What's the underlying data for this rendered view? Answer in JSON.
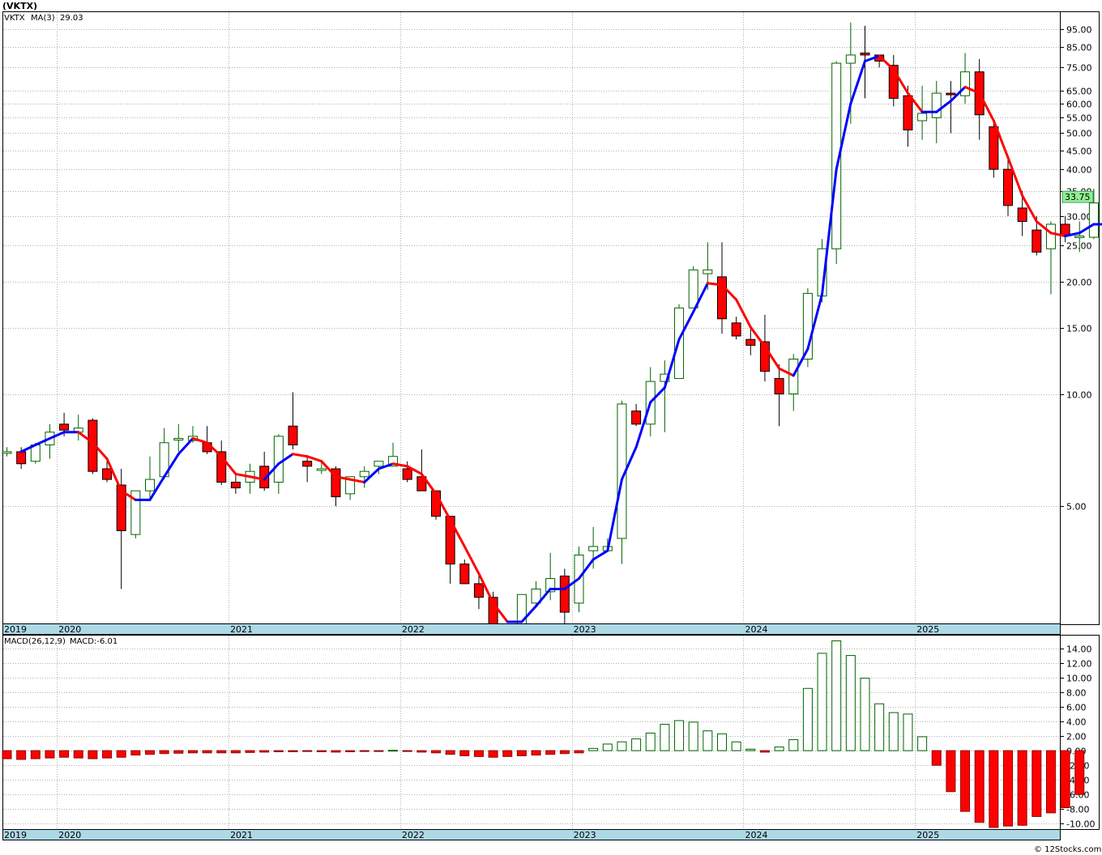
{
  "header": {
    "ticker": "(VKTX)"
  },
  "price_legend": {
    "symbol": "VKTX",
    "ma_label": "MA(3)",
    "ma_value": "29.03"
  },
  "macd_legend": {
    "label": "MACD(26,12,9)",
    "value_label": "MACD:-6.01"
  },
  "last_price_tag": "33.75",
  "watermark": "© 12Stocks.com",
  "colors": {
    "up": "#006400",
    "down": "#ff0000",
    "ma_up": "#0000ff",
    "ma_down": "#ff0000",
    "grid": "#b0b0b0",
    "time_band": "#add8e6",
    "price_tag": "#90ee90"
  },
  "chart_data": [
    {
      "type": "candlestick",
      "title": "(VKTX)",
      "scale": "log",
      "ylim": [
        2.45,
        105
      ],
      "grid": true,
      "y_ticks": [
        "95.00",
        "85.00",
        "75.00",
        "65.00",
        "60.00",
        "55.00",
        "50.00",
        "45.00",
        "40.00",
        "35.00",
        "30.00",
        "25.00",
        "20.00",
        "15.00",
        "10.00",
        "5.00"
      ],
      "x_labels": [
        "2019",
        "2020",
        "2021",
        "2022",
        "2023",
        "2024",
        "2025"
      ],
      "x_label_index": [
        0,
        4,
        16,
        28,
        40,
        52,
        64
      ],
      "candles": [
        [
          7.0,
          7.2,
          6.8,
          7.0
        ],
        [
          7.0,
          7.2,
          6.3,
          6.5
        ],
        [
          6.6,
          7.4,
          6.5,
          7.3
        ],
        [
          7.3,
          8.3,
          6.7,
          7.9
        ],
        [
          8.3,
          8.9,
          7.7,
          8.0
        ],
        [
          7.9,
          8.8,
          7.5,
          8.1
        ],
        [
          8.5,
          8.6,
          6.1,
          6.2
        ],
        [
          6.3,
          6.6,
          5.8,
          5.9
        ],
        [
          5.7,
          6.3,
          3.0,
          4.3
        ],
        [
          4.2,
          5.4,
          4.1,
          5.5
        ],
        [
          5.5,
          6.8,
          5.2,
          5.9
        ],
        [
          6.0,
          8.1,
          5.9,
          7.4
        ],
        [
          7.6,
          8.3,
          7.0,
          7.6
        ],
        [
          7.5,
          8.2,
          7.4,
          7.7
        ],
        [
          7.4,
          8.2,
          6.9,
          7.0
        ],
        [
          7.0,
          7.5,
          5.7,
          5.8
        ],
        [
          5.8,
          6.1,
          5.4,
          5.6
        ],
        [
          5.8,
          6.5,
          5.4,
          6.2
        ],
        [
          6.4,
          7.0,
          5.5,
          5.6
        ],
        [
          5.8,
          7.8,
          5.4,
          7.7
        ],
        [
          8.2,
          10.1,
          7.1,
          7.3
        ],
        [
          6.6,
          6.8,
          5.8,
          6.4
        ],
        [
          6.3,
          6.6,
          6.1,
          6.3
        ],
        [
          6.3,
          6.4,
          5.0,
          5.3
        ],
        [
          5.4,
          6.0,
          5.2,
          6.0
        ],
        [
          6.0,
          6.4,
          5.6,
          6.2
        ],
        [
          6.4,
          6.6,
          6.1,
          6.6
        ],
        [
          6.4,
          7.4,
          6.4,
          6.8
        ],
        [
          6.3,
          6.6,
          5.8,
          5.9
        ],
        [
          6.0,
          7.1,
          5.6,
          5.5
        ],
        [
          5.5,
          5.5,
          4.6,
          4.7
        ],
        [
          4.7,
          4.7,
          3.1,
          3.5
        ],
        [
          3.5,
          3.6,
          3.1,
          3.1
        ],
        [
          3.1,
          3.3,
          2.65,
          2.85
        ],
        [
          2.85,
          2.95,
          2.2,
          2.3
        ],
        [
          2.2,
          2.3,
          2.1,
          2.1
        ],
        [
          2.3,
          2.9,
          2.05,
          2.9
        ],
        [
          2.75,
          3.15,
          2.7,
          3.0
        ],
        [
          2.95,
          3.75,
          2.8,
          3.2
        ],
        [
          3.25,
          3.4,
          2.4,
          2.6
        ],
        [
          2.75,
          3.9,
          2.6,
          3.7
        ],
        [
          3.8,
          4.4,
          3.4,
          3.9
        ],
        [
          3.8,
          4.1,
          3.9,
          3.9
        ],
        [
          4.1,
          9.6,
          3.5,
          9.4
        ],
        [
          9.0,
          9.4,
          8.2,
          8.3
        ],
        [
          8.3,
          11.8,
          7.7,
          10.8
        ],
        [
          10.8,
          12.3,
          7.9,
          11.3
        ],
        [
          11.0,
          17.4,
          11.3,
          17.0
        ],
        [
          17.0,
          22.0,
          17.0,
          21.5
        ],
        [
          21.0,
          25.5,
          19.0,
          21.5
        ],
        [
          20.6,
          25.5,
          14.5,
          15.9
        ],
        [
          15.5,
          16.1,
          14.0,
          14.3
        ],
        [
          14.0,
          14.9,
          12.7,
          13.5
        ],
        [
          13.8,
          16.3,
          10.8,
          11.5
        ],
        [
          11.0,
          12.0,
          8.2,
          10.0
        ],
        [
          10.0,
          12.8,
          9.0,
          12.4
        ],
        [
          12.4,
          19.2,
          11.8,
          18.6
        ],
        [
          18.3,
          26.0,
          17.6,
          24.5
        ],
        [
          24.5,
          78.0,
          22.3,
          77.0
        ],
        [
          77.0,
          99.0,
          53.0,
          81.0
        ],
        [
          82.0,
          97.0,
          62.0,
          81.0
        ],
        [
          81.0,
          79.0,
          75.0,
          78.0
        ],
        [
          76.0,
          81.0,
          59.0,
          62.0
        ],
        [
          63.0,
          67.0,
          46.0,
          51.0
        ],
        [
          54.0,
          67.0,
          48.0,
          56.5
        ],
        [
          55.0,
          69.0,
          47.0,
          64.0
        ],
        [
          64.0,
          69.0,
          50.0,
          63.5
        ],
        [
          63.0,
          82.0,
          60.0,
          73.0
        ],
        [
          73.0,
          79.0,
          48.0,
          56.0
        ],
        [
          52.0,
          54.0,
          38.0,
          40.0
        ],
        [
          40.0,
          43.0,
          30.0,
          32.0
        ],
        [
          31.5,
          35.0,
          26.5,
          29.0
        ],
        [
          27.5,
          30.0,
          23.5,
          24.0
        ],
        [
          24.5,
          29.0,
          18.5,
          28.5
        ],
        [
          28.5,
          30.0,
          25.5,
          26.5
        ],
        [
          26.5,
          29.0,
          24.0,
          26.5
        ],
        [
          26.3,
          35.5,
          26.0,
          32.5
        ],
        [
          32.0,
          42.5,
          23.0,
          27.0
        ],
        [
          27.0,
          28.0,
          23.0,
          26.5
        ],
        [
          26.5,
          37.0,
          25.5,
          33.75
        ]
      ],
      "ma": [
        null,
        7.0,
        7.3,
        7.6,
        7.9,
        7.9,
        7.4,
        6.7,
        5.5,
        5.2,
        5.2,
        6.0,
        6.9,
        7.6,
        7.4,
        6.8,
        6.1,
        6.0,
        5.9,
        6.5,
        6.9,
        6.8,
        6.6,
        6.0,
        5.9,
        5.8,
        6.3,
        6.5,
        6.4,
        6.1,
        5.4,
        4.6,
        3.9,
        3.3,
        2.75,
        2.45,
        2.45,
        2.7,
        3.0,
        3.0,
        3.2,
        3.6,
        3.8,
        5.9,
        7.2,
        9.5,
        10.4,
        14.0,
        16.6,
        19.8,
        19.6,
        17.9,
        15.1,
        13.4,
        11.7,
        11.2,
        13.2,
        18.5,
        40.0,
        60.0,
        78.0,
        80.5,
        74.0,
        64.0,
        57.0,
        57.0,
        61.0,
        66.5,
        64.0,
        54.0,
        43.0,
        34.0,
        29.0,
        27.0,
        26.5,
        27.0,
        28.5,
        28.5,
        28.5,
        29.03
      ]
    },
    {
      "type": "bar",
      "title": "MACD(26,12,9)",
      "ylim": [
        -10.5,
        15.5
      ],
      "y_ticks": [
        "14.00",
        "12.00",
        "10.00",
        "8.00",
        "6.00",
        "4.00",
        "2.00",
        "0.00",
        "-2.00",
        "-4.00",
        "-6.00",
        "-8.00",
        "-10.00"
      ],
      "values": [
        -1.1,
        -1.2,
        -1.1,
        -1.0,
        -0.9,
        -1.0,
        -1.1,
        -1.0,
        -0.9,
        -0.6,
        -0.5,
        -0.4,
        -0.35,
        -0.3,
        -0.3,
        -0.3,
        -0.3,
        -0.25,
        -0.2,
        -0.15,
        -0.15,
        -0.1,
        -0.15,
        -0.2,
        -0.15,
        -0.1,
        -0.05,
        0.05,
        -0.1,
        -0.2,
        -0.3,
        -0.5,
        -0.7,
        -0.8,
        -0.9,
        -0.8,
        -0.7,
        -0.6,
        -0.5,
        -0.4,
        -0.3,
        0.3,
        0.9,
        1.2,
        1.6,
        2.4,
        3.6,
        4.1,
        3.9,
        2.7,
        2.3,
        1.2,
        0.2,
        -0.2,
        0.5,
        1.5,
        8.5,
        13.3,
        15.0,
        13.0,
        9.9,
        6.4,
        5.2,
        5.0,
        1.9,
        -2.0,
        -5.6,
        -8.3,
        -9.8,
        -10.5,
        -10.3,
        -10.2,
        -9.0,
        -8.5,
        -7.8,
        -6.0
      ]
    }
  ]
}
